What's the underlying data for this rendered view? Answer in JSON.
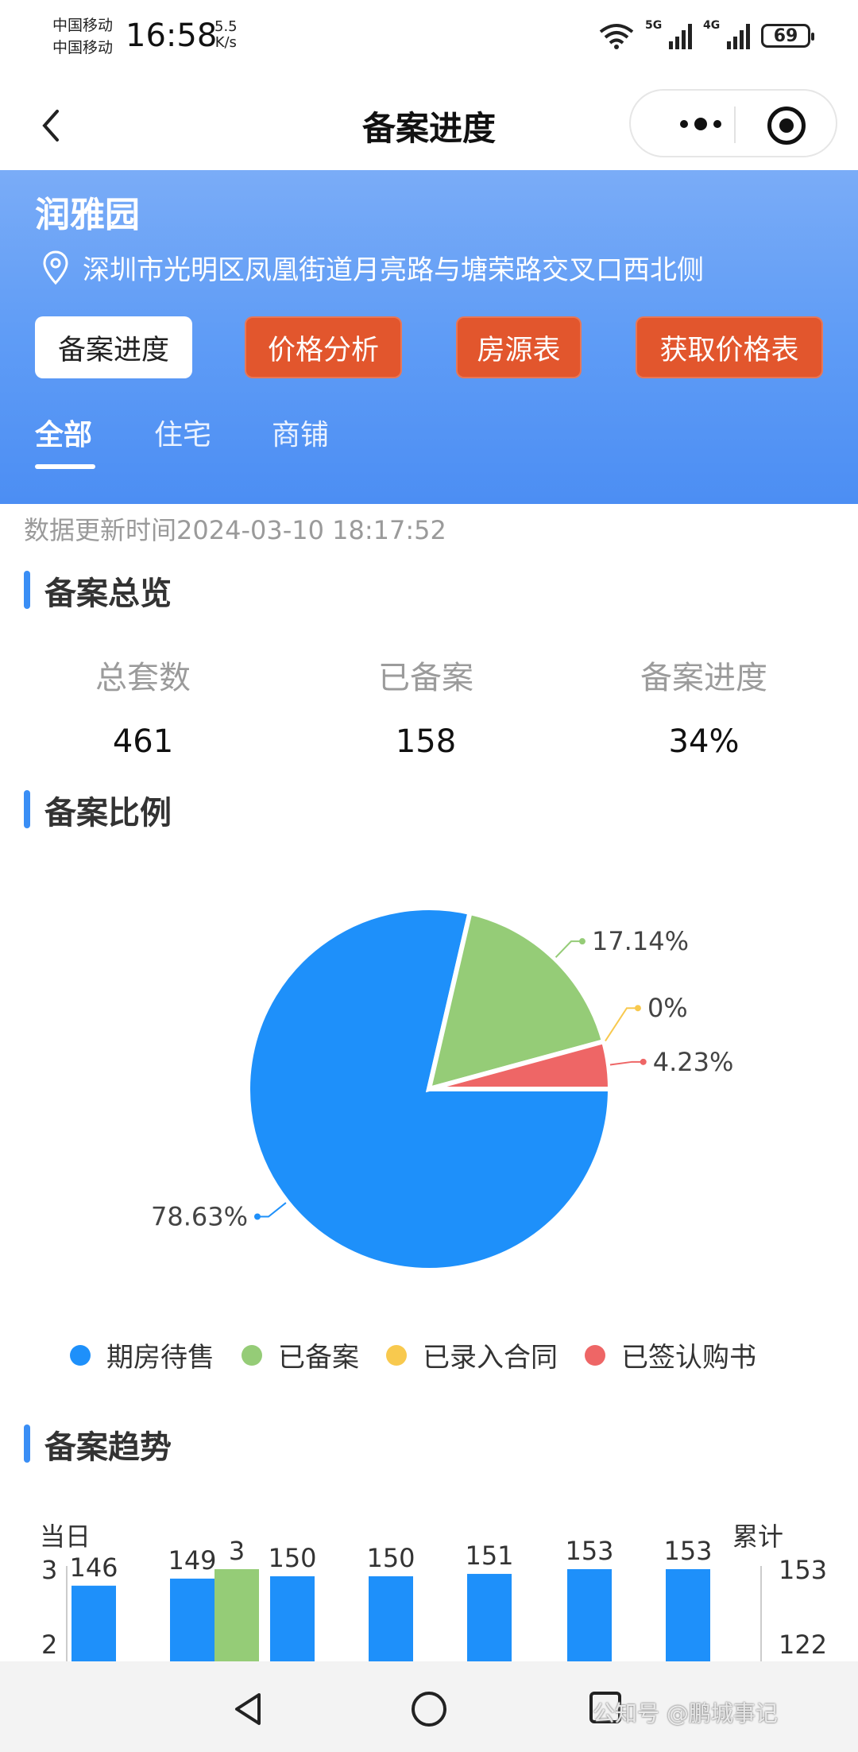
{
  "status": {
    "carrier1": "中国移动",
    "carrier2": "中国移动",
    "time": "16:58",
    "speed_value": "5.5",
    "speed_unit": "K/s",
    "net1": "5G",
    "net2": "4G",
    "battery": "69"
  },
  "header": {
    "title": "备案进度"
  },
  "banner": {
    "project_name": "润雅园",
    "address": "深圳市光明区凤凰街道月亮路与塘荣路交叉口西北侧",
    "buttons": [
      {
        "label": "备案进度",
        "active": true
      },
      {
        "label": "价格分析"
      },
      {
        "label": "房源表"
      },
      {
        "label": "获取价格表"
      }
    ],
    "tabs": [
      {
        "label": "全部",
        "active": true
      },
      {
        "label": "住宅"
      },
      {
        "label": "商铺"
      }
    ]
  },
  "update_time": "数据更新时间2024-03-10 18:17:52",
  "overview": {
    "title": "备案总览",
    "items": [
      {
        "label": "总套数",
        "value": "461"
      },
      {
        "label": "已备案",
        "value": "158"
      },
      {
        "label": "备案进度",
        "value": "34%"
      }
    ]
  },
  "ratio": {
    "title": "备案比例"
  },
  "trend": {
    "title": "备案趋势",
    "left_axis_title": "当日",
    "right_axis_title": "累计",
    "left_ticks": [
      "3",
      "2"
    ],
    "right_ticks": [
      "153",
      "122"
    ]
  },
  "colors": {
    "blue": "#1e90fa",
    "green": "#95cc77",
    "yellow": "#f8c94e",
    "red": "#ee6666",
    "accent_orange": "#e2562d"
  },
  "chart_data": [
    {
      "type": "pie",
      "slices": [
        {
          "name": "期房待售",
          "value": 78.63,
          "label": "78.63%",
          "color": "#1e90fa"
        },
        {
          "name": "已备案",
          "value": 17.14,
          "label": "17.14%",
          "color": "#95cc77"
        },
        {
          "name": "已录入合同",
          "value": 0,
          "label": "0%",
          "color": "#f8c94e"
        },
        {
          "name": "已签认购书",
          "value": 4.23,
          "label": "4.23%",
          "color": "#ee6666"
        }
      ],
      "legend": [
        "期房待售",
        "已备案",
        "已录入合同",
        "已签认购书"
      ],
      "legend_position": "bottom"
    },
    {
      "type": "bar",
      "series": [
        {
          "values": [
            146,
            149,
            150,
            150,
            151,
            153,
            153
          ]
        }
      ],
      "daily_values": [
        3
      ],
      "ylim_left": [
        2,
        3
      ],
      "ylim_right": [
        122,
        153
      ]
    }
  ],
  "watermark": "公知号 @鹏城事记"
}
